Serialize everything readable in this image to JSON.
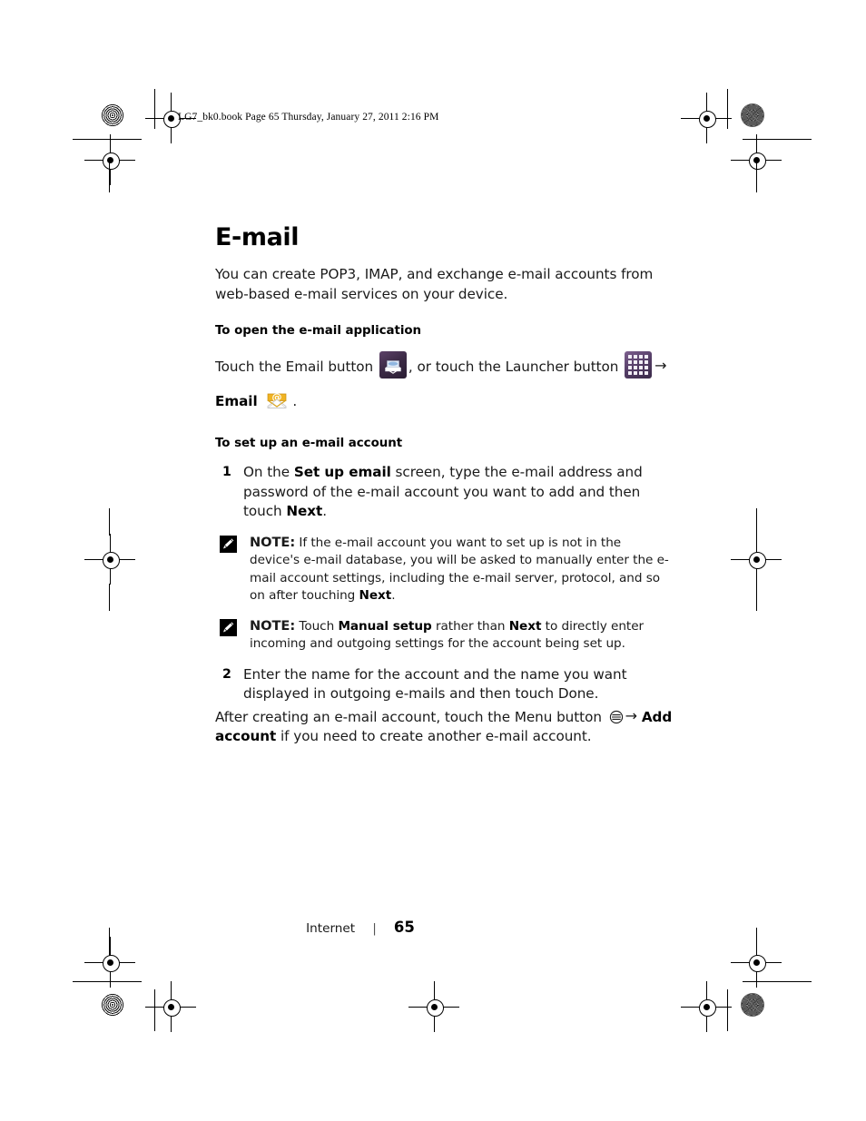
{
  "printer_slug": "LG7_bk0.book  Page 65  Thursday, January 27, 2011  2:16 PM",
  "document": {
    "title": "E-mail",
    "intro": "You can create POP3, IMAP, and exchange e-mail accounts from web-based e-mail services on your device.",
    "sections": [
      {
        "heading": "To open the e-mail application",
        "line1_part1": "Touch the Email button",
        "line1_part2": ", or touch the Launcher button",
        "line2_bold": "Email",
        "line2_trailing": "."
      },
      {
        "heading": "To set up an e-mail account",
        "steps": [
          {
            "num": "1",
            "text_a": "On the ",
            "bold_a": "Set up email",
            "text_b": " screen, type the e-mail address and password of the e-mail account you want to add and then touch ",
            "bold_b": "Next",
            "text_c": "."
          },
          {
            "num": "2",
            "text_a": "Enter the name for the account and the name you want displayed in outgoing e-mails and then touch Done.",
            "bold_a": "",
            "text_b": "",
            "bold_b": "",
            "text_c": ""
          }
        ],
        "notes": [
          {
            "label": "NOTE:",
            "text_a": " If the e-mail account you want to set up is not in the device's e-mail database, you will be asked to manually enter the e-mail account settings, including the e-mail server, protocol, and so on after touching ",
            "bold_a": "Next",
            "text_b": ".",
            "bold_b": "",
            "text_c": ""
          },
          {
            "label": "NOTE:",
            "text_a": " Touch ",
            "bold_a": "Manual setup",
            "text_b": " rather than ",
            "bold_b": "Next",
            "text_c": " to directly enter incoming and outgoing settings for the account being set up."
          }
        ],
        "closing": {
          "text_a": "After creating an e-mail account, touch the Menu button ",
          "text_b": " ",
          "bold_a": "Add account",
          "text_c": " if you need to create another e-mail account."
        }
      }
    ]
  },
  "footer": {
    "chapter": "Internet",
    "separator": "|",
    "page_number": "65"
  },
  "icons": {
    "email_app": "email-app-icon",
    "launcher": "launcher-grid-icon",
    "email_at": "email-at-icon",
    "menu_button": "menu-button-icon",
    "note": "note-pencil-icon",
    "arrow": "→"
  },
  "colors": {
    "page_background": "#ffffff",
    "text": "#1a1a1a",
    "heading": "#000000",
    "icon_purple_dark": "#2a1d33",
    "icon_purple_light": "#7d5f8e",
    "icon_gold": "#f0b323"
  }
}
